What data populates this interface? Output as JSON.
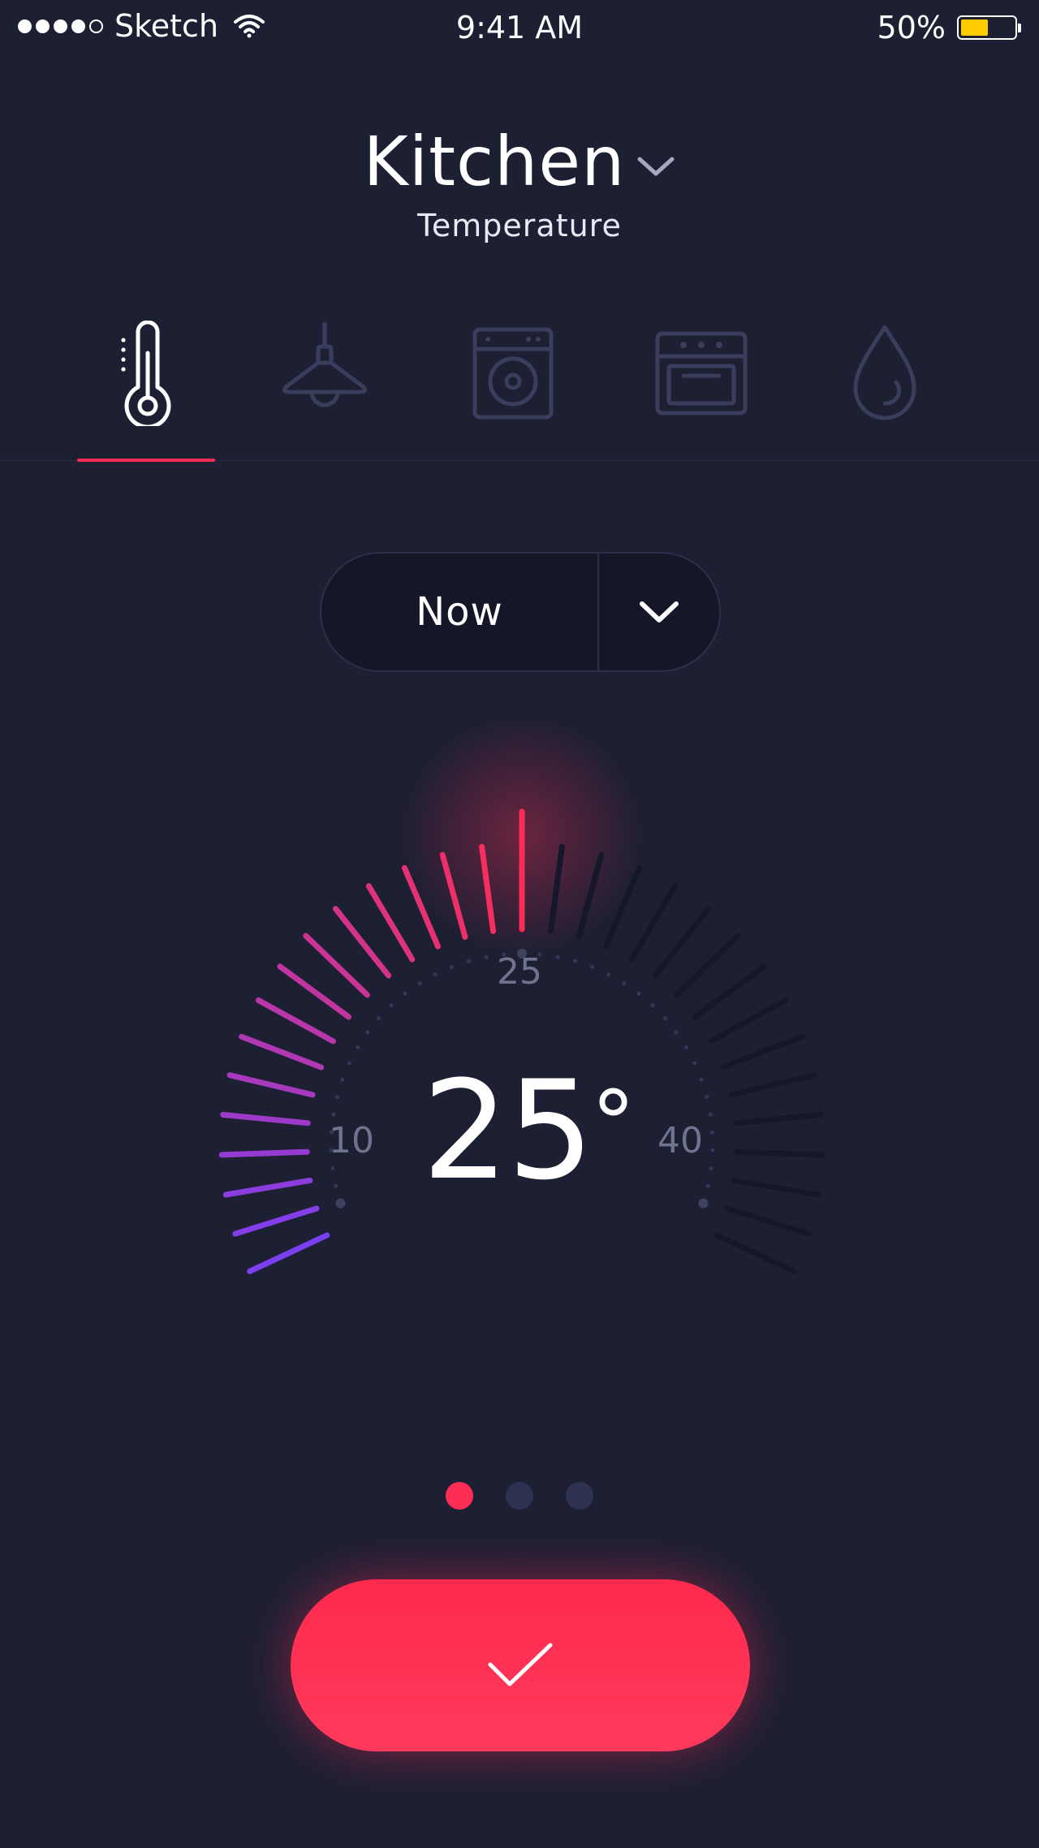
{
  "status_bar": {
    "carrier": "Sketch",
    "time": "9:41 AM",
    "battery_percent": "50%",
    "battery_level": 0.5,
    "signal_bars": 4,
    "signal_max": 5
  },
  "header": {
    "room": "Kitchen",
    "subtitle": "Temperature"
  },
  "tabs": [
    {
      "name": "temperature",
      "icon": "thermometer-icon",
      "active": true
    },
    {
      "name": "light",
      "icon": "ceiling-lamp-icon",
      "active": false
    },
    {
      "name": "washer",
      "icon": "washing-machine-icon",
      "active": false
    },
    {
      "name": "oven",
      "icon": "oven-icon",
      "active": false
    },
    {
      "name": "humidity",
      "icon": "water-drop-icon",
      "active": false
    }
  ],
  "period": {
    "value": "Now"
  },
  "dial": {
    "current": "25",
    "unit": "°",
    "min_label": "10",
    "mid_label": "25",
    "max_label": "40",
    "min": 10,
    "max": 40,
    "value": 25
  },
  "pager": {
    "pages": 3,
    "active_index": 0
  },
  "colors": {
    "background": "#1d1f33",
    "accent": "#ff2d55",
    "gradient_start": "#7b3ff2",
    "gradient_end": "#ff2d55",
    "inactive_tick": "#15172a",
    "icon_inactive": "#3a3e5c"
  }
}
